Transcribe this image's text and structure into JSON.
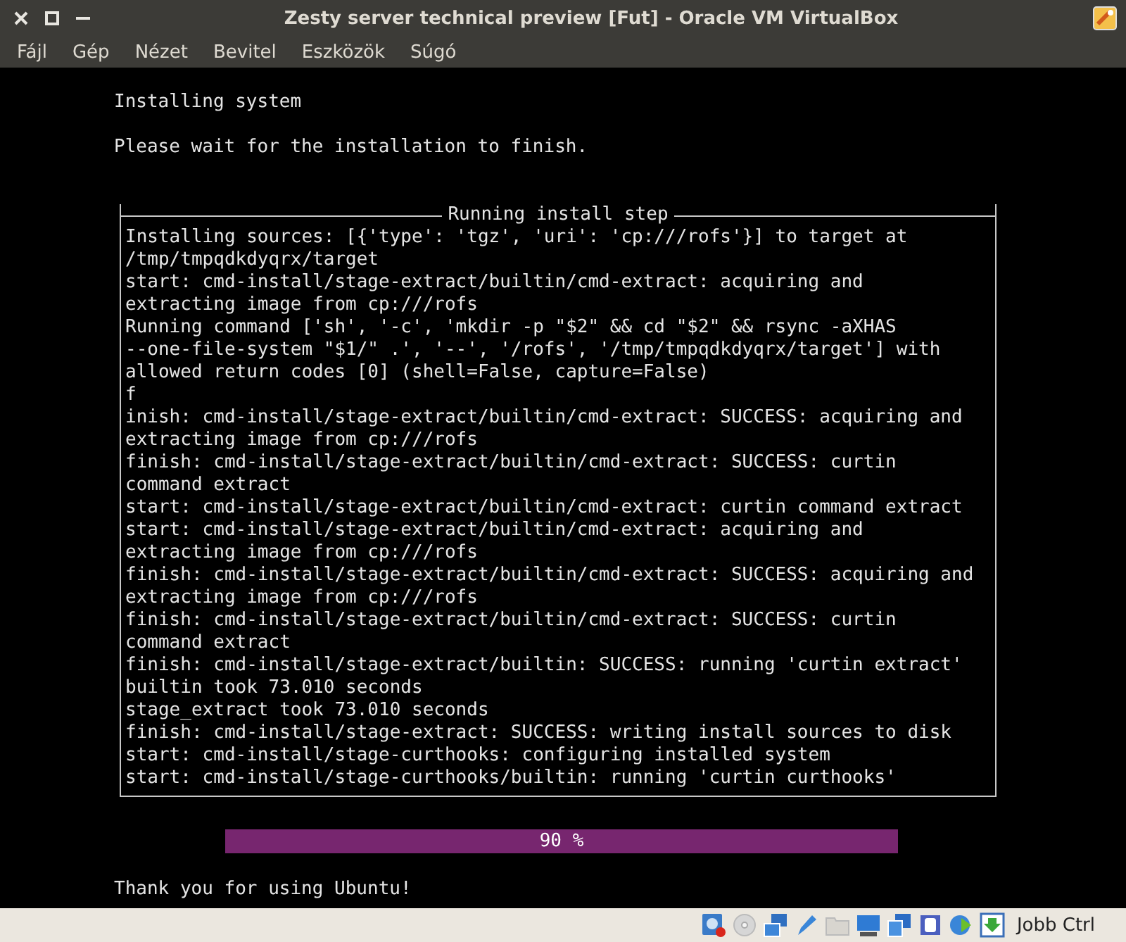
{
  "window": {
    "title": "Zesty server technical preview [Fut] - Oracle VM VirtualBox"
  },
  "menu": [
    "Fájl",
    "Gép",
    "Nézet",
    "Bevitel",
    "Eszközök",
    "Súgó"
  ],
  "console": {
    "heading": "Installing system",
    "message": "Please wait for the installation to finish.",
    "dialog": {
      "title": "Running install step",
      "lines": [
        "Installing sources: [{'type': 'tgz', 'uri': 'cp:///rofs'}] to target at",
        "/tmp/tmpqdkdyqrx/target",
        "start: cmd-install/stage-extract/builtin/cmd-extract: acquiring and",
        "extracting image from cp:///rofs",
        "Running command ['sh', '-c', 'mkdir -p \"$2\" && cd \"$2\" && rsync -aXHAS",
        "--one-file-system \"$1/\" .', '--', '/rofs', '/tmp/tmpqdkdyqrx/target'] with",
        "allowed return codes [0] (shell=False, capture=False)",
        "f",
        "inish: cmd-install/stage-extract/builtin/cmd-extract: SUCCESS: acquiring and",
        "extracting image from cp:///rofs",
        "finish: cmd-install/stage-extract/builtin/cmd-extract: SUCCESS: curtin",
        "command extract",
        "start: cmd-install/stage-extract/builtin/cmd-extract: curtin command extract",
        "start: cmd-install/stage-extract/builtin/cmd-extract: acquiring and",
        "extracting image from cp:///rofs",
        "finish: cmd-install/stage-extract/builtin/cmd-extract: SUCCESS: acquiring and",
        "extracting image from cp:///rofs",
        "finish: cmd-install/stage-extract/builtin/cmd-extract: SUCCESS: curtin",
        "command extract",
        "finish: cmd-install/stage-extract/builtin: SUCCESS: running 'curtin extract'",
        "builtin took 73.010 seconds",
        "stage_extract took 73.010 seconds",
        "finish: cmd-install/stage-extract: SUCCESS: writing install sources to disk",
        "start: cmd-install/stage-curthooks: configuring installed system",
        "start: cmd-install/stage-curthooks/builtin: running 'curtin curthooks'"
      ]
    },
    "progress": {
      "label": "90 %",
      "level": 1
    },
    "footer": "Thank you for using Ubuntu!"
  },
  "status_bar": {
    "host_key": "Jobb Ctrl"
  }
}
